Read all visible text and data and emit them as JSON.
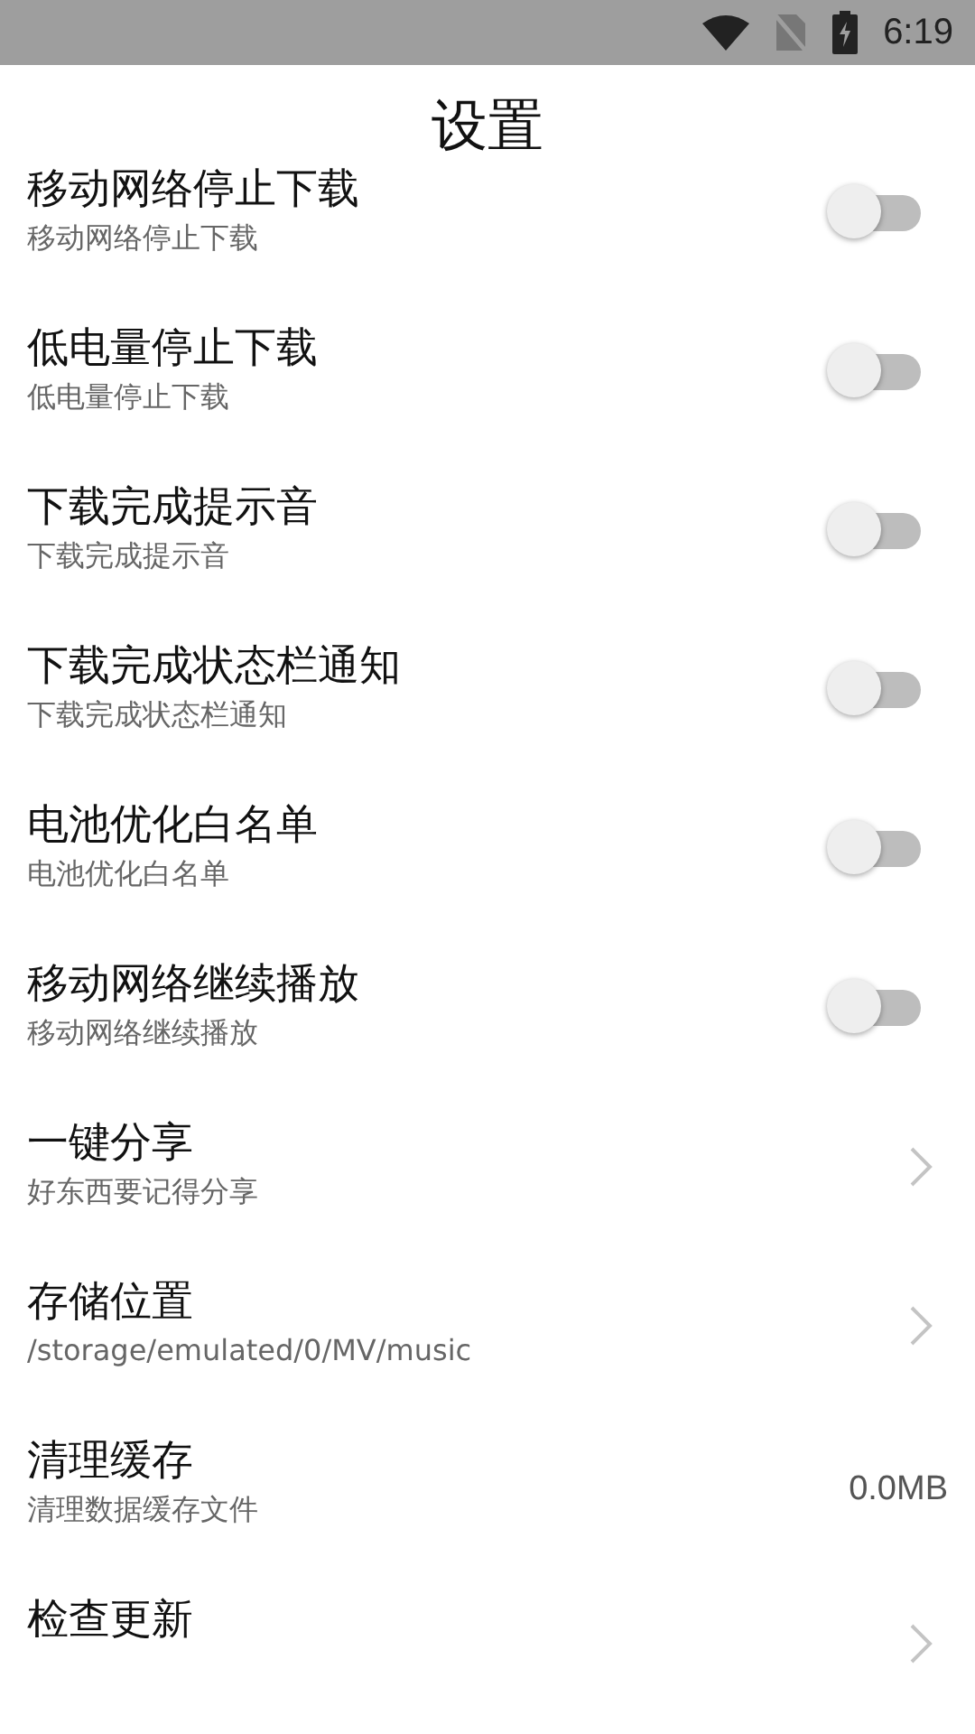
{
  "status_bar": {
    "time": "6:19"
  },
  "title": "设置",
  "settings": [
    {
      "kind": "toggle",
      "title": "移动网络停止下载",
      "subtitle": "移动网络停止下载",
      "on": false
    },
    {
      "kind": "toggle",
      "title": "低电量停止下载",
      "subtitle": "低电量停止下载",
      "on": false
    },
    {
      "kind": "toggle",
      "title": "下载完成提示音",
      "subtitle": "下载完成提示音",
      "on": false
    },
    {
      "kind": "toggle",
      "title": "下载完成状态栏通知",
      "subtitle": "下载完成状态栏通知",
      "on": false
    },
    {
      "kind": "toggle",
      "title": "电池优化白名单",
      "subtitle": "电池优化白名单",
      "on": false
    },
    {
      "kind": "toggle",
      "title": "移动网络继续播放",
      "subtitle": "移动网络继续播放",
      "on": false
    },
    {
      "kind": "link",
      "title": "一键分享",
      "subtitle": "好东西要记得分享"
    },
    {
      "kind": "link",
      "title": "存储位置",
      "subtitle": "/storage/emulated/0/MV/music"
    },
    {
      "kind": "value",
      "title": "清理缓存",
      "subtitle": "清理数据缓存文件",
      "value": "0.0MB"
    },
    {
      "kind": "link",
      "title": "检查更新"
    }
  ]
}
